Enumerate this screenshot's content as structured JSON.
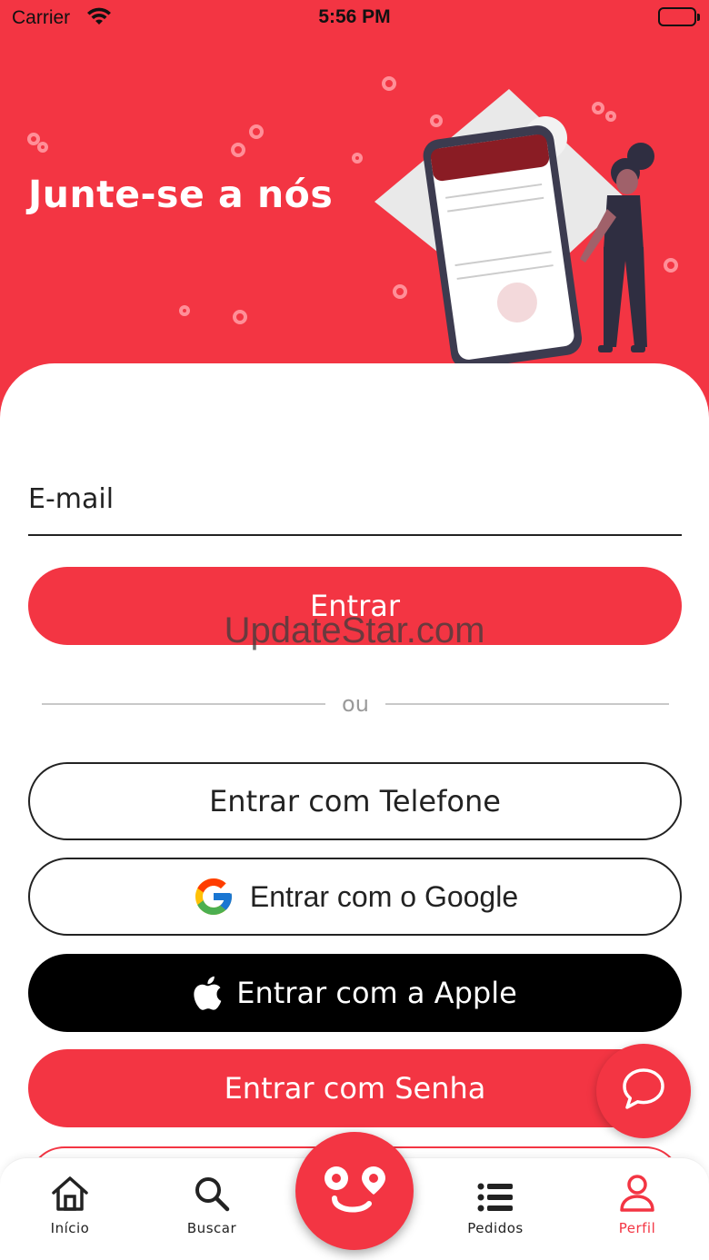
{
  "status_bar": {
    "carrier": "Carrier",
    "time": "5:56 PM"
  },
  "header": {
    "title": "Junte-se a nós"
  },
  "form": {
    "email_placeholder": "E-mail",
    "submit_label": "Entrar"
  },
  "watermark": "UpdateStar.com",
  "divider_text": "ou",
  "auth_buttons": {
    "phone": "Entrar com Telefone",
    "google": "Entrar com o Google",
    "apple": "Entrar com a Apple",
    "password": "Entrar com Senha"
  },
  "tabbar": {
    "items": [
      {
        "label": "Início",
        "icon": "home-icon"
      },
      {
        "label": "Buscar",
        "icon": "search-icon"
      },
      {
        "label": "Pedidos",
        "icon": "list-icon"
      },
      {
        "label": "Perfil",
        "icon": "user-icon"
      }
    ],
    "active": "Perfil"
  },
  "colors": {
    "brand": "#F33543",
    "text": "#222222",
    "apple": "#000000"
  }
}
